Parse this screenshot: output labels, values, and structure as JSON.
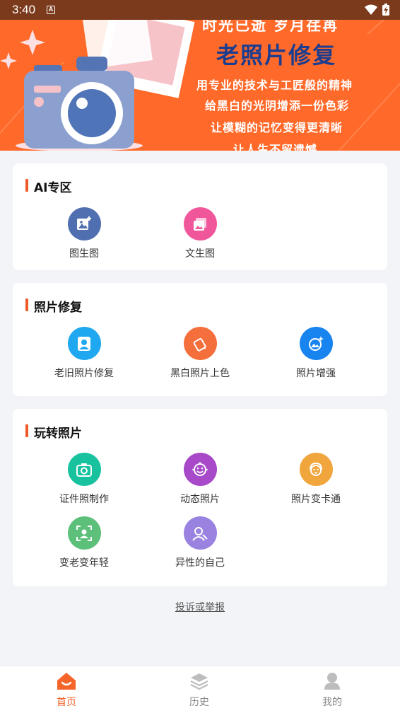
{
  "status_bar": {
    "time": "3:40",
    "notification_icon": "A"
  },
  "banner": {
    "top_line": "时光已逝 岁月荏苒",
    "title": "老照片修复",
    "line1": "用专业的技术与工匠般的精神",
    "line2": "给黑白的光阴增添一份色彩",
    "line3": "让模糊的记忆变得更清晰",
    "line4": "让人生不留遗憾"
  },
  "sections": {
    "ai": {
      "title": "AI专区",
      "items": [
        {
          "label": "图生图",
          "icon": "image-add-icon",
          "color": "#4f6fb0"
        },
        {
          "label": "文生图",
          "icon": "image-stack-icon",
          "color": "#f0569a"
        }
      ]
    },
    "repair": {
      "title": "照片修复",
      "items": [
        {
          "label": "老旧照片修复",
          "icon": "portrait-icon",
          "color": "#1fa8f0"
        },
        {
          "label": "黑白照片上色",
          "icon": "paint-bucket-icon",
          "color": "#f46f3c"
        },
        {
          "label": "照片增强",
          "icon": "image-sparkle-icon",
          "color": "#1784f0"
        }
      ]
    },
    "fun": {
      "title": "玩转照片",
      "items": [
        {
          "label": "证件照制作",
          "icon": "camera-icon",
          "color": "#18c29e"
        },
        {
          "label": "动态照片",
          "icon": "smile-face-icon",
          "color": "#a749c9"
        },
        {
          "label": "照片变卡通",
          "icon": "cartoon-face-icon",
          "color": "#f0a53d"
        },
        {
          "label": "变老变年轻",
          "icon": "face-scan-icon",
          "color": "#5dc07a"
        },
        {
          "label": "异性的自己",
          "icon": "person-swap-icon",
          "color": "#9a82e0"
        }
      ]
    }
  },
  "report_link": "投诉或举报",
  "bottom_nav": {
    "home": "首页",
    "history": "历史",
    "mine": "我的"
  },
  "colors": {
    "accent": "#f5642a",
    "banner": "#ff6a2a"
  }
}
